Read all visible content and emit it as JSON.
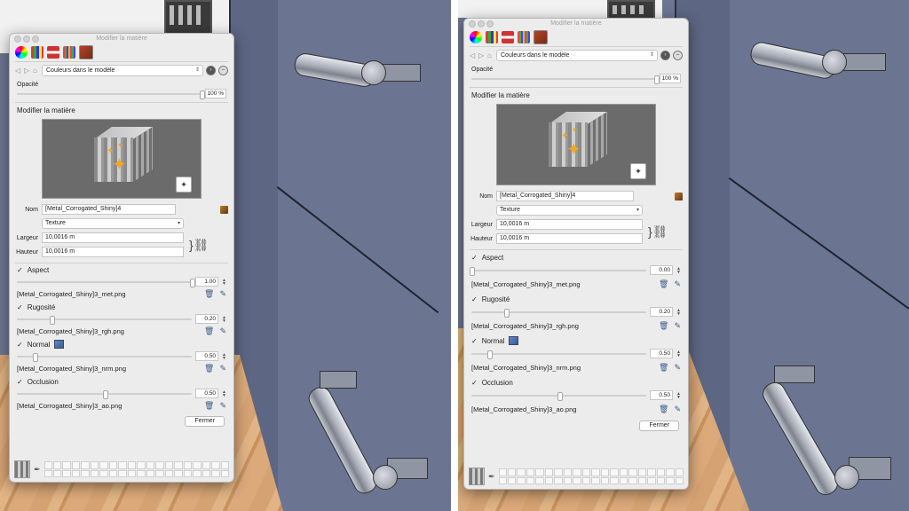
{
  "dialog": {
    "title": "Modifier la matière",
    "model_select": "Couleurs dans le modèle",
    "opacity_label": "Opacité",
    "opacity_value": "100 %",
    "edit_section": "Modifier la matière",
    "name_label": "Nom",
    "name_value": "[Metal_Corrogated_Shiny]4",
    "texture_option": "Texture",
    "width_label": "Largeur",
    "width_value": "10,0016 m",
    "height_label": "Hauteur",
    "height_value": "10,0016 m",
    "close_label": "Fermer"
  },
  "panels": [
    {
      "maps": [
        {
          "label": "Aspect",
          "value": "1.00",
          "file": "[Metal_Corrogated_Shiny]3_met.png",
          "fraction": 1.0
        },
        {
          "label": "Rugosité",
          "value": "0.20",
          "file": "[Metal_Corrogated_Shiny]3_rgh.png",
          "fraction": 0.2
        },
        {
          "label": "Normal",
          "value": "0.50",
          "file": "[Metal_Corrogated_Shiny]3_nrm.png",
          "fraction": 0.1
        },
        {
          "label": "Occlusion",
          "value": "0.50",
          "file": "[Metal_Corrogated_Shiny]3_ao.png",
          "fraction": 0.5
        }
      ]
    },
    {
      "maps": [
        {
          "label": "Aspect",
          "value": "0.00",
          "file": "[Metal_Corrogated_Shiny]3_met.png",
          "fraction": 0.0
        },
        {
          "label": "Rugosité",
          "value": "0.20",
          "file": "[Metal_Corrogated_Shiny]3_rgh.png",
          "fraction": 0.2
        },
        {
          "label": "Normal",
          "value": "0.50",
          "file": "[Metal_Corrogated_Shiny]3_nrm.png",
          "fraction": 0.1
        },
        {
          "label": "Occlusion",
          "value": "0.50",
          "file": "[Metal_Corrogated_Shiny]3_ao.png",
          "fraction": 0.5
        }
      ]
    }
  ],
  "icons": {
    "check": "✓",
    "trash": "🗑",
    "edit": "✎",
    "sparkle": "✦",
    "dropper": "✒"
  },
  "colors": {
    "wall": "#6c7692",
    "panel": "#ececec",
    "sparkle": "#f5a623"
  }
}
